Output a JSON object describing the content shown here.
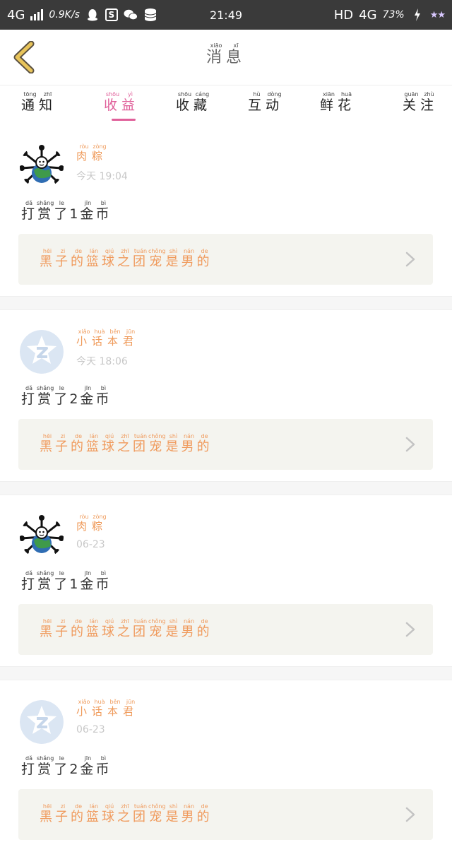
{
  "status_bar": {
    "network": "4G",
    "speed": "0.9K/s",
    "time": "21:49",
    "hd": "HD",
    "network2": "4G",
    "battery": "73%",
    "icons": [
      "signal-icon",
      "qq-icon",
      "s-icon",
      "wechat-icon",
      "database-icon",
      "charging-icon",
      "stars-icon"
    ]
  },
  "header": {
    "title": [
      {
        "char": "消",
        "pinyin": "xiāo"
      },
      {
        "char": "息",
        "pinyin": "xī"
      }
    ]
  },
  "tabs": [
    {
      "chars": [
        {
          "char": "通",
          "pinyin": "tōng"
        },
        {
          "char": "知",
          "pinyin": "zhī"
        }
      ],
      "active": false
    },
    {
      "chars": [
        {
          "char": "收",
          "pinyin": "shōu"
        },
        {
          "char": "益",
          "pinyin": "yì"
        }
      ],
      "active": true
    },
    {
      "chars": [
        {
          "char": "收",
          "pinyin": "shōu"
        },
        {
          "char": "藏",
          "pinyin": "cáng"
        }
      ],
      "active": false
    },
    {
      "chars": [
        {
          "char": "互",
          "pinyin": "hù"
        },
        {
          "char": "动",
          "pinyin": "dòng"
        }
      ],
      "active": false
    },
    {
      "chars": [
        {
          "char": "鲜",
          "pinyin": "xiān"
        },
        {
          "char": "花",
          "pinyin": "huā"
        }
      ],
      "active": false
    },
    {
      "chars": [
        {
          "char": "关",
          "pinyin": "guān"
        },
        {
          "char": "注",
          "pinyin": "zhù"
        }
      ],
      "active": false
    }
  ],
  "messages": [
    {
      "avatar": "globe-avatar",
      "user": [
        {
          "char": "肉",
          "pinyin": "ròu"
        },
        {
          "char": "粽",
          "pinyin": "zòng"
        }
      ],
      "time": "今天 19:04",
      "action": [
        {
          "char": "打",
          "pinyin": "dǎ"
        },
        {
          "char": "赏",
          "pinyin": "shǎng"
        },
        {
          "char": "了",
          "pinyin": "le"
        },
        {
          "char": "1",
          "pinyin": ""
        },
        {
          "char": "金",
          "pinyin": "jīn"
        },
        {
          "char": "币",
          "pinyin": "bì"
        }
      ],
      "ref": [
        {
          "char": "黑",
          "pinyin": "hēi"
        },
        {
          "char": "子",
          "pinyin": "zi"
        },
        {
          "char": "的",
          "pinyin": "de"
        },
        {
          "char": "篮",
          "pinyin": "lán"
        },
        {
          "char": "球",
          "pinyin": "qiú"
        },
        {
          "char": "之",
          "pinyin": "zhī"
        },
        {
          "char": "团",
          "pinyin": "tuán"
        },
        {
          "char": "宠",
          "pinyin": "chǒng"
        },
        {
          "char": "是",
          "pinyin": "shì"
        },
        {
          "char": "男",
          "pinyin": "nán"
        },
        {
          "char": "的",
          "pinyin": "de"
        }
      ]
    },
    {
      "avatar": "qq-avatar",
      "user": [
        {
          "char": "小",
          "pinyin": "xiǎo"
        },
        {
          "char": "话",
          "pinyin": "huà"
        },
        {
          "char": "本",
          "pinyin": "běn"
        },
        {
          "char": "君",
          "pinyin": "jūn"
        }
      ],
      "time": "今天 18:06",
      "action": [
        {
          "char": "打",
          "pinyin": "dǎ"
        },
        {
          "char": "赏",
          "pinyin": "shǎng"
        },
        {
          "char": "了",
          "pinyin": "le"
        },
        {
          "char": "2",
          "pinyin": ""
        },
        {
          "char": "金",
          "pinyin": "jīn"
        },
        {
          "char": "币",
          "pinyin": "bì"
        }
      ],
      "ref": [
        {
          "char": "黑",
          "pinyin": "hēi"
        },
        {
          "char": "子",
          "pinyin": "zi"
        },
        {
          "char": "的",
          "pinyin": "de"
        },
        {
          "char": "篮",
          "pinyin": "lán"
        },
        {
          "char": "球",
          "pinyin": "qiú"
        },
        {
          "char": "之",
          "pinyin": "zhī"
        },
        {
          "char": "团",
          "pinyin": "tuán"
        },
        {
          "char": "宠",
          "pinyin": "chǒng"
        },
        {
          "char": "是",
          "pinyin": "shì"
        },
        {
          "char": "男",
          "pinyin": "nán"
        },
        {
          "char": "的",
          "pinyin": "de"
        }
      ]
    },
    {
      "avatar": "globe-avatar",
      "user": [
        {
          "char": "肉",
          "pinyin": "ròu"
        },
        {
          "char": "粽",
          "pinyin": "zòng"
        }
      ],
      "time": "06-23",
      "action": [
        {
          "char": "打",
          "pinyin": "dǎ"
        },
        {
          "char": "赏",
          "pinyin": "shǎng"
        },
        {
          "char": "了",
          "pinyin": "le"
        },
        {
          "char": "1",
          "pinyin": ""
        },
        {
          "char": "金",
          "pinyin": "jīn"
        },
        {
          "char": "币",
          "pinyin": "bì"
        }
      ],
      "ref": [
        {
          "char": "黑",
          "pinyin": "hēi"
        },
        {
          "char": "子",
          "pinyin": "zi"
        },
        {
          "char": "的",
          "pinyin": "de"
        },
        {
          "char": "篮",
          "pinyin": "lán"
        },
        {
          "char": "球",
          "pinyin": "qiú"
        },
        {
          "char": "之",
          "pinyin": "zhī"
        },
        {
          "char": "团",
          "pinyin": "tuán"
        },
        {
          "char": "宠",
          "pinyin": "chǒng"
        },
        {
          "char": "是",
          "pinyin": "shì"
        },
        {
          "char": "男",
          "pinyin": "nán"
        },
        {
          "char": "的",
          "pinyin": "de"
        }
      ]
    },
    {
      "avatar": "qq-avatar",
      "user": [
        {
          "char": "小",
          "pinyin": "xiǎo"
        },
        {
          "char": "话",
          "pinyin": "huà"
        },
        {
          "char": "本",
          "pinyin": "běn"
        },
        {
          "char": "君",
          "pinyin": "jūn"
        }
      ],
      "time": "06-23",
      "action": [
        {
          "char": "打",
          "pinyin": "dǎ"
        },
        {
          "char": "赏",
          "pinyin": "shǎng"
        },
        {
          "char": "了",
          "pinyin": "le"
        },
        {
          "char": "2",
          "pinyin": ""
        },
        {
          "char": "金",
          "pinyin": "jīn"
        },
        {
          "char": "币",
          "pinyin": "bì"
        }
      ],
      "ref": [
        {
          "char": "黑",
          "pinyin": "hēi"
        },
        {
          "char": "子",
          "pinyin": "zi"
        },
        {
          "char": "的",
          "pinyin": "de"
        },
        {
          "char": "篮",
          "pinyin": "lán"
        },
        {
          "char": "球",
          "pinyin": "qiú"
        },
        {
          "char": "之",
          "pinyin": "zhī"
        },
        {
          "char": "团",
          "pinyin": "tuán"
        },
        {
          "char": "宠",
          "pinyin": "chǒng"
        },
        {
          "char": "是",
          "pinyin": "shì"
        },
        {
          "char": "男",
          "pinyin": "nán"
        },
        {
          "char": "的",
          "pinyin": "de"
        }
      ]
    }
  ],
  "colors": {
    "accent": "#e0609a",
    "username": "#ef9a5a",
    "ref_bg": "#f4f4ef",
    "status_bar": "#3a3a3a",
    "back_arrow": "#e8c45a"
  }
}
